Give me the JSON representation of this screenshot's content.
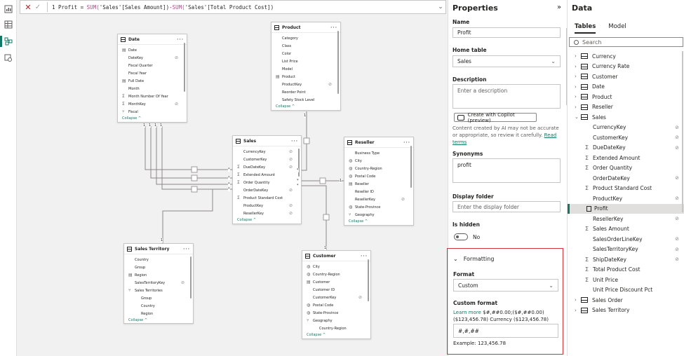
{
  "formula_bar": {
    "line_no": "1",
    "p1": "Profit = ",
    "fn1": "SUM(",
    "a1": "'Sales'[Sales Amount]",
    "p2": ")-",
    "fn2": "SUM(",
    "a2": "'Sales'[Total Product Cost]",
    "p3": ")"
  },
  "model": {
    "date": {
      "title": "Date",
      "fields": [
        {
          "label": "Date",
          "sig": "cal",
          "hidden": false
        },
        {
          "label": "DateKey",
          "sig": "",
          "hidden": true
        },
        {
          "label": "Fiscal Quarter",
          "sig": "",
          "hidden": false
        },
        {
          "label": "Fiscal Year",
          "sig": "",
          "hidden": false
        },
        {
          "label": "Full Date",
          "sig": "cal",
          "hidden": false
        },
        {
          "label": "Month",
          "sig": "",
          "hidden": false
        },
        {
          "label": "Month Number Of Year",
          "sig": "Σ",
          "hidden": false
        },
        {
          "label": "MonthKey",
          "sig": "Σ",
          "hidden": true
        },
        {
          "label": "Fiscal",
          "sig": "hier",
          "hidden": false
        }
      ],
      "collapse": "Collapse ^"
    },
    "product": {
      "title": "Product",
      "fields": [
        {
          "label": "Category",
          "sig": "",
          "hidden": false
        },
        {
          "label": "Class",
          "sig": "",
          "hidden": false
        },
        {
          "label": "Color",
          "sig": "",
          "hidden": false
        },
        {
          "label": "List Price",
          "sig": "",
          "hidden": false
        },
        {
          "label": "Model",
          "sig": "",
          "hidden": false
        },
        {
          "label": "Product",
          "sig": "cal",
          "hidden": false
        },
        {
          "label": "ProductKey",
          "sig": "",
          "hidden": true
        },
        {
          "label": "Reorder Point",
          "sig": "",
          "hidden": false
        },
        {
          "label": "Safety Stock Level",
          "sig": "",
          "hidden": false
        }
      ],
      "collapse": "Collapse ^"
    },
    "sales": {
      "title": "Sales",
      "fields": [
        {
          "label": "CurrencyKey",
          "sig": "",
          "hidden": true
        },
        {
          "label": "CustomerKey",
          "sig": "",
          "hidden": true
        },
        {
          "label": "DueDateKey",
          "sig": "Σ",
          "hidden": true
        },
        {
          "label": "Extended Amount",
          "sig": "Σ",
          "hidden": false
        },
        {
          "label": "Order Quantity",
          "sig": "Σ",
          "hidden": false
        },
        {
          "label": "OrderDateKey",
          "sig": "",
          "hidden": true
        },
        {
          "label": "Product Standard Cost",
          "sig": "Σ",
          "hidden": false
        },
        {
          "label": "ProductKey",
          "sig": "",
          "hidden": true
        },
        {
          "label": "ResellerKey",
          "sig": "",
          "hidden": true
        }
      ],
      "collapse": "Collapse ^"
    },
    "reseller": {
      "title": "Reseller",
      "fields": [
        {
          "label": "Business Type",
          "sig": "",
          "hidden": false
        },
        {
          "label": "City",
          "sig": "geo",
          "hidden": false
        },
        {
          "label": "Country-Region",
          "sig": "geo",
          "hidden": false
        },
        {
          "label": "Postal Code",
          "sig": "geo",
          "hidden": false
        },
        {
          "label": "Reseller",
          "sig": "cal",
          "hidden": false
        },
        {
          "label": "Reseller ID",
          "sig": "",
          "hidden": false
        },
        {
          "label": "ResellerKey",
          "sig": "",
          "hidden": true
        },
        {
          "label": "State-Province",
          "sig": "geo",
          "hidden": false
        },
        {
          "label": "Geography",
          "sig": "hier",
          "hidden": false
        }
      ],
      "collapse": "Collapse ^"
    },
    "territory": {
      "title": "Sales Territory",
      "fields": [
        {
          "label": "Country",
          "sig": "",
          "hidden": false
        },
        {
          "label": "Group",
          "sig": "",
          "hidden": false
        },
        {
          "label": "Region",
          "sig": "cal",
          "hidden": false
        },
        {
          "label": "SalesTerritoryKey",
          "sig": "",
          "hidden": true
        },
        {
          "label": "Sales Territories",
          "sig": "hier",
          "hidden": false
        },
        {
          "label": "Group",
          "sig": "ind",
          "hidden": false
        },
        {
          "label": "Country",
          "sig": "ind",
          "hidden": false
        },
        {
          "label": "Region",
          "sig": "ind",
          "hidden": false
        }
      ],
      "collapse": "Collapse ^"
    },
    "customer": {
      "title": "Customer",
      "fields": [
        {
          "label": "City",
          "sig": "geo",
          "hidden": false
        },
        {
          "label": "Country-Region",
          "sig": "geo",
          "hidden": false
        },
        {
          "label": "Customer",
          "sig": "cal",
          "hidden": false
        },
        {
          "label": "Customer ID",
          "sig": "",
          "hidden": false
        },
        {
          "label": "CustomerKey",
          "sig": "",
          "hidden": true
        },
        {
          "label": "Postal Code",
          "sig": "geo",
          "hidden": false
        },
        {
          "label": "State-Province",
          "sig": "geo",
          "hidden": false
        },
        {
          "label": "Geography",
          "sig": "hier",
          "hidden": false
        },
        {
          "label": "Country-Region",
          "sig": "ind",
          "hidden": false
        }
      ],
      "collapse": "Collapse ^"
    },
    "rel_labels": {
      "one": "1",
      "many": "*"
    }
  },
  "properties": {
    "title": "Properties",
    "name_label": "Name",
    "name_value": "Profit",
    "home_table_label": "Home table",
    "home_table_value": "Sales",
    "description_label": "Description",
    "description_placeholder": "Enter a description",
    "copilot_button": "Create with Copilot (preview)",
    "ai_note": "Content created by AI may not be accurate or appropriate, so review it carefully.",
    "ai_link": "Read terms",
    "synonyms_label": "Synonyms",
    "synonyms_value": "profit",
    "display_folder_label": "Display folder",
    "display_folder_placeholder": "Enter the display folder",
    "is_hidden_label": "Is hidden",
    "is_hidden_value": "No",
    "formatting_header": "Formatting",
    "format_label": "Format",
    "format_value": "Custom",
    "custom_format_label": "Custom format",
    "learn_more": "Learn more",
    "format_examples": " $#,##0.00;($#,##0.00) ($123,456.78) Currency ($123,456.78)",
    "custom_format_value": "#,#,##",
    "example": "Example: 123,456.78"
  },
  "data_pane": {
    "title": "Data",
    "tabs": [
      "Tables",
      "Model"
    ],
    "search_placeholder": "Search",
    "tree": [
      {
        "label": "Currency",
        "kind": "table",
        "expanded": false
      },
      {
        "label": "Currency Rate",
        "kind": "table",
        "expanded": false
      },
      {
        "label": "Customer",
        "kind": "table",
        "expanded": false
      },
      {
        "label": "Date",
        "kind": "table",
        "expanded": false
      },
      {
        "label": "Product",
        "kind": "table",
        "expanded": false
      },
      {
        "label": "Reseller",
        "kind": "table",
        "expanded": false
      },
      {
        "label": "Sales",
        "kind": "table",
        "expanded": true
      },
      {
        "label": "CurrencyKey",
        "kind": "field",
        "sig": "",
        "hidden": true
      },
      {
        "label": "CustomerKey",
        "kind": "field",
        "sig": "",
        "hidden": true
      },
      {
        "label": "DueDateKey",
        "kind": "field",
        "sig": "Σ",
        "hidden": true
      },
      {
        "label": "Extended Amount",
        "kind": "field",
        "sig": "Σ",
        "hidden": false
      },
      {
        "label": "Order Quantity",
        "kind": "field",
        "sig": "Σ",
        "hidden": false
      },
      {
        "label": "OrderDateKey",
        "kind": "field",
        "sig": "",
        "hidden": true
      },
      {
        "label": "Product Standard Cost",
        "kind": "field",
        "sig": "Σ",
        "hidden": false
      },
      {
        "label": "ProductKey",
        "kind": "field",
        "sig": "",
        "hidden": true
      },
      {
        "label": "Profit",
        "kind": "measure",
        "selected": true
      },
      {
        "label": "ResellerKey",
        "kind": "field",
        "sig": "",
        "hidden": true
      },
      {
        "label": "Sales Amount",
        "kind": "field",
        "sig": "Σ",
        "hidden": false
      },
      {
        "label": "SalesOrderLineKey",
        "kind": "field",
        "sig": "",
        "hidden": true
      },
      {
        "label": "SalesTerritoryKey",
        "kind": "field",
        "sig": "",
        "hidden": true
      },
      {
        "label": "ShipDateKey",
        "kind": "field",
        "sig": "Σ",
        "hidden": true
      },
      {
        "label": "Total Product Cost",
        "kind": "field",
        "sig": "Σ",
        "hidden": false
      },
      {
        "label": "Unit Price",
        "kind": "field",
        "sig": "Σ",
        "hidden": false
      },
      {
        "label": "Unit Price Discount Pct",
        "kind": "field",
        "sig": "",
        "hidden": false
      },
      {
        "label": "Sales Order",
        "kind": "table",
        "expanded": false
      },
      {
        "label": "Sales Territory",
        "kind": "table",
        "expanded": false
      }
    ]
  },
  "colors": {
    "accent": "#117865",
    "highlight_border": "#d13438"
  }
}
